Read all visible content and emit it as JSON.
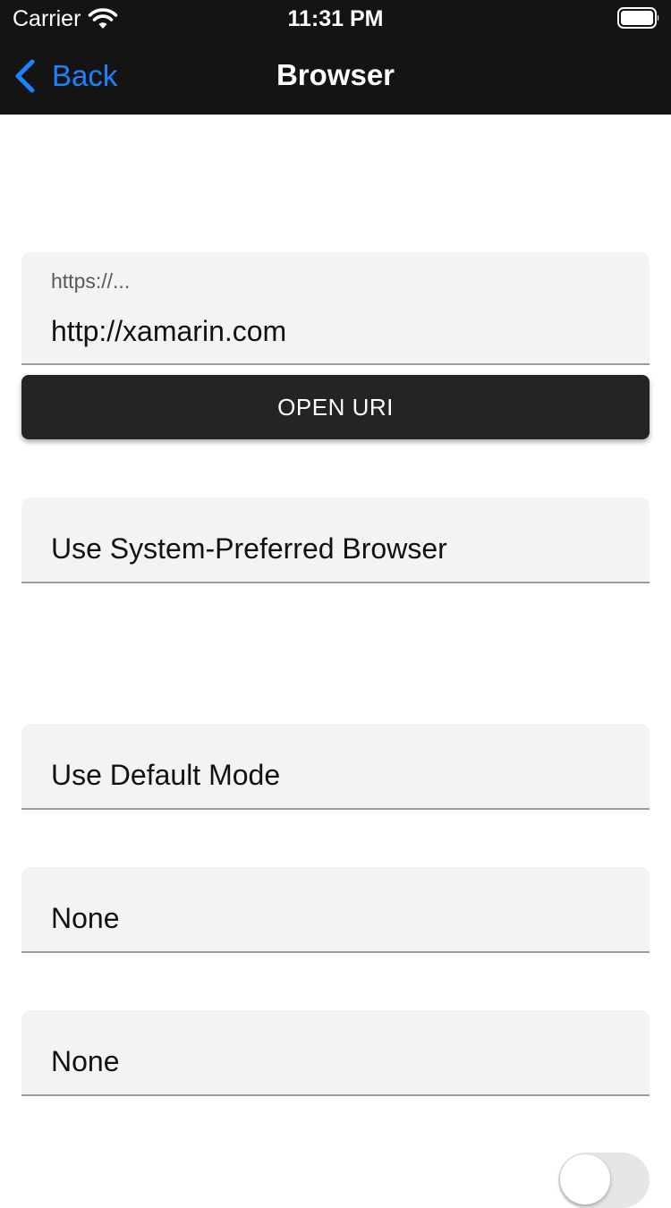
{
  "status_bar": {
    "carrier": "Carrier",
    "time": "11:31 PM",
    "wifi_icon": "wifi-icon",
    "battery_icon": "battery-icon"
  },
  "nav": {
    "back_label": "Back",
    "back_icon": "chevron-left-icon",
    "title": "Browser",
    "accent_color": "#1a84ff",
    "bar_color": "#141414"
  },
  "uri_field": {
    "placeholder": "https://...",
    "value": "http://xamarin.com"
  },
  "open_button": {
    "label": "OPEN URI"
  },
  "pickers": {
    "launch_type": "Use System-Preferred Browser",
    "launch_mode": "Use Default Mode",
    "title_mode": "None",
    "flags": "None"
  },
  "toggle": {
    "on": false
  }
}
